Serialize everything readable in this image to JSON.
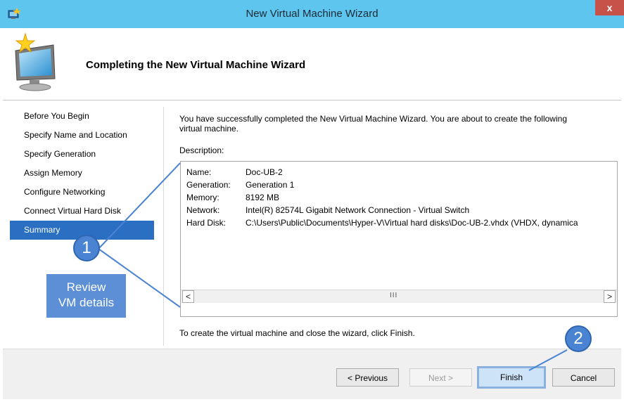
{
  "window": {
    "title": "New Virtual Machine Wizard",
    "close_glyph": "x"
  },
  "header": {
    "title": "Completing the New Virtual Machine Wizard"
  },
  "nav": {
    "items": [
      {
        "label": "Before You Begin"
      },
      {
        "label": "Specify Name and Location"
      },
      {
        "label": "Specify Generation"
      },
      {
        "label": "Assign Memory"
      },
      {
        "label": "Configure Networking"
      },
      {
        "label": "Connect Virtual Hard Disk"
      },
      {
        "label": "Summary"
      }
    ],
    "active_index": 6
  },
  "main": {
    "intro": "You have successfully completed the New Virtual Machine Wizard. You are about to create the following virtual machine.",
    "description_label": "Description:",
    "details": [
      {
        "key": "Name:",
        "value": "Doc-UB-2"
      },
      {
        "key": "Generation:",
        "value": "Generation 1"
      },
      {
        "key": "Memory:",
        "value": "8192 MB"
      },
      {
        "key": "Network:",
        "value": "Intel(R) 82574L Gigabit Network Connection - Virtual Switch"
      },
      {
        "key": "Hard Disk:",
        "value": "C:\\Users\\Public\\Documents\\Hyper-V\\Virtual hard disks\\Doc-UB-2.vhdx (VHDX, dynamica"
      }
    ],
    "scroll_left": "<",
    "scroll_right": ">",
    "scroll_grip": "III",
    "footer_text": "To create the virtual machine and close the wizard, click Finish."
  },
  "buttons": {
    "previous": "< Previous",
    "next": "Next >",
    "finish": "Finish",
    "cancel": "Cancel"
  },
  "annotations": {
    "badge_1": "1",
    "badge_2": "2",
    "callout_line1": "Review",
    "callout_line2": "VM details"
  },
  "colors": {
    "titlebar": "#5ec5ef",
    "close_button": "#c7524a",
    "nav_active": "#2a6fc1",
    "annotation_blue": "#4a83d1",
    "callout_box": "#5c8fd6",
    "finish_highlight": "#8ab0dd"
  },
  "icons": {
    "app": "hyper-v-vm-icon",
    "hero": "new-computer-star-icon"
  }
}
